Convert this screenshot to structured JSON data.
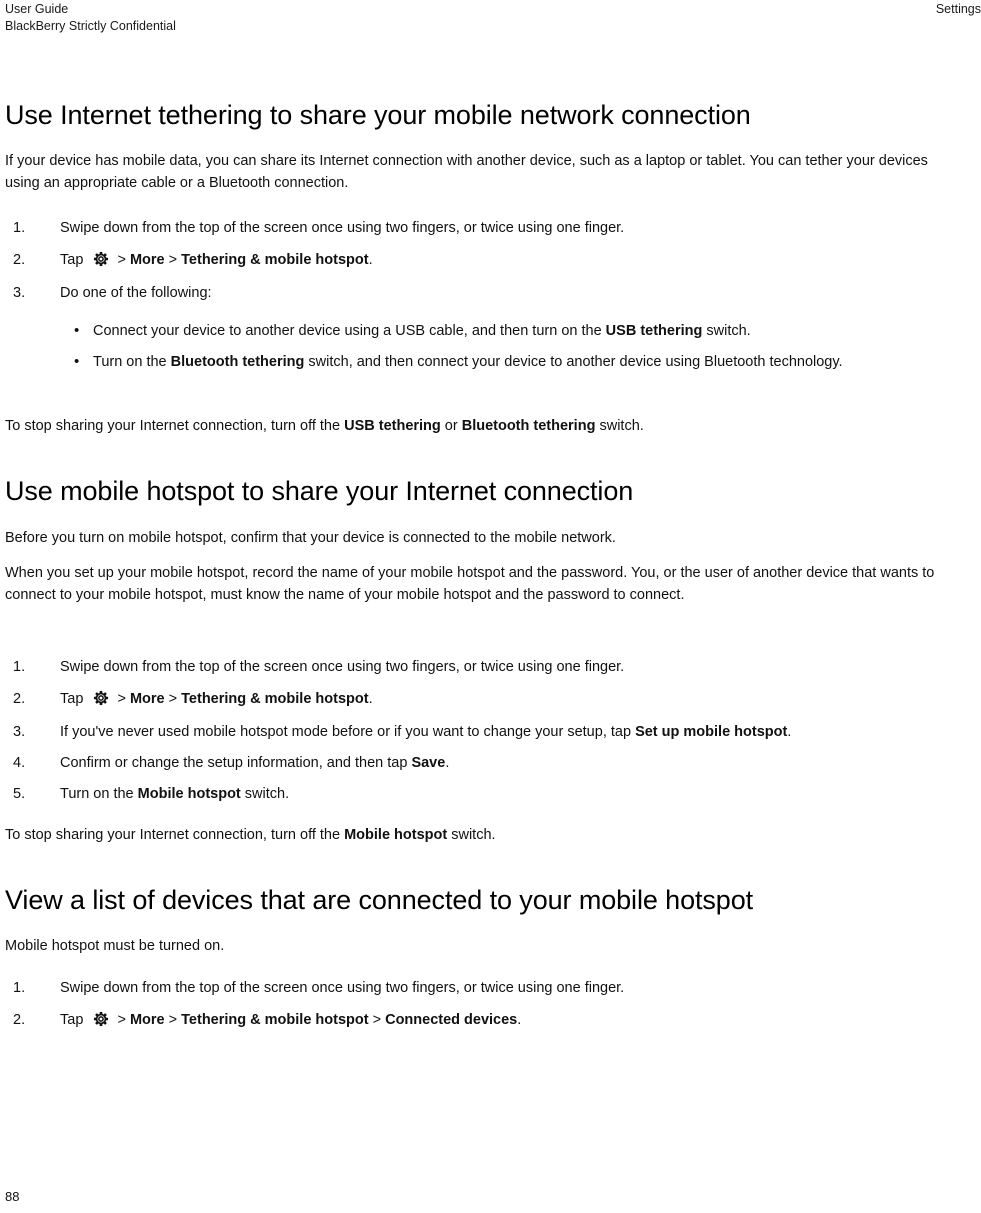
{
  "header": {
    "left_line1": "User Guide",
    "left_line2": "BlackBerry Strictly Confidential",
    "right": "Settings"
  },
  "footer": {
    "page_number": "88"
  },
  "icons": {
    "gear": "gear-icon"
  },
  "sections": [
    {
      "id": "internet-tethering",
      "title": "Use Internet tethering to share your mobile network connection",
      "intro": "If your device has mobile data, you can share its Internet connection with another device, such as a laptop or tablet. You can tether your devices using an appropriate cable or a Bluetooth connection.",
      "steps": [
        {
          "marker": "1.",
          "text": "Swipe down from the top of the screen once using two fingers, or twice using one finger."
        },
        {
          "marker": "2.",
          "prefix": "Tap",
          "sep1": ">",
          "bold1": "More",
          "sep2": ">",
          "bold2": "Tethering & mobile hotspot",
          "suffix": "."
        },
        {
          "marker": "3.",
          "text": "Do one of the following:"
        }
      ],
      "bullets": [
        {
          "dot": "•",
          "pre": "Connect your device to another device using a USB cable, and then turn on the ",
          "bold": "USB tethering",
          "post": " switch."
        },
        {
          "dot": "•",
          "pre": "Turn on the ",
          "bold": "Bluetooth tethering",
          "post": " switch, and then connect your device to another device using Bluetooth technology."
        }
      ],
      "outro": {
        "pre": "To stop sharing your Internet connection, turn off the ",
        "bold1": "USB tethering",
        "mid": " or ",
        "bold2": "Bluetooth tethering",
        "post": " switch."
      }
    },
    {
      "id": "mobile-hotspot",
      "title": "Use mobile hotspot to share your Internet connection",
      "intro1": "Before you turn on mobile hotspot, confirm that your device is connected to the mobile network.",
      "intro2": "When you set up your mobile hotspot, record the name of your mobile hotspot and the password. You, or the user of another device that wants to connect to your mobile hotspot, must know the name of your mobile hotspot and the password to connect.",
      "steps": [
        {
          "marker": "1.",
          "text": "Swipe down from the top of the screen once using two fingers, or twice using one finger."
        },
        {
          "marker": "2.",
          "prefix": "Tap",
          "sep1": ">",
          "bold1": "More",
          "sep2": ">",
          "bold2": "Tethering & mobile hotspot",
          "suffix": "."
        },
        {
          "marker": "3.",
          "pre": "If you've never used mobile hotspot mode before or if you want to change your setup, tap ",
          "bold": "Set up mobile hotspot",
          "post": "."
        },
        {
          "marker": "4.",
          "pre": "Confirm or change the setup information, and then tap ",
          "bold": "Save",
          "post": "."
        },
        {
          "marker": "5.",
          "pre": "Turn on the ",
          "bold": "Mobile hotspot",
          "post": " switch."
        }
      ],
      "outro": {
        "pre": "To stop sharing your Internet connection, turn off the ",
        "bold1": "Mobile hotspot",
        "post": " switch."
      }
    },
    {
      "id": "connected-devices",
      "title": "View a list of devices that are connected to your mobile hotspot",
      "intro": "Mobile hotspot must be turned on.",
      "steps": [
        {
          "marker": "1.",
          "text": "Swipe down from the top of the screen once using two fingers, or twice using one finger."
        },
        {
          "marker": "2.",
          "prefix": "Tap",
          "sep1": ">",
          "bold1": "More",
          "sep2": ">",
          "bold2": "Tethering & mobile hotspot",
          "sep3": ">",
          "bold3": "Connected devices",
          "suffix": "."
        }
      ]
    }
  ]
}
